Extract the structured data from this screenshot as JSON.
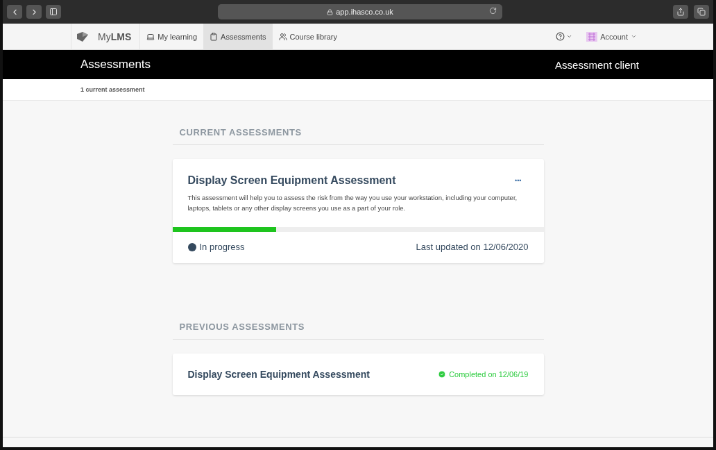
{
  "browser": {
    "url": "app.ihasco.co.uk"
  },
  "nav": {
    "brand": {
      "light": "My",
      "bold": "LMS"
    },
    "items": [
      {
        "label": "My learning",
        "selected": false
      },
      {
        "label": "Assessments",
        "selected": true
      },
      {
        "label": "Course library",
        "selected": false
      }
    ],
    "account": "Account"
  },
  "header": {
    "title": "Assessments",
    "client": "Assessment client"
  },
  "subheader": "1 current assessment",
  "current": {
    "heading": "CURRENT ASSESSMENTS",
    "cards": [
      {
        "title": "Display Screen Equipment Assessment",
        "description": "This assessment will help you to assess the risk from the way you use your workstation, including your computer, laptops, tablets or any other display screens you use as a part of your role.",
        "menu": "•••",
        "level": 0.28,
        "status": "In progress",
        "updated": "Last updated on 12/06/2020"
      }
    ]
  },
  "previous": {
    "heading": "PREVIOUS ASSESSMENTS",
    "items": [
      {
        "title": "Display Screen Equipment Assessment",
        "status": "Completed on 12/06/19"
      }
    ]
  }
}
